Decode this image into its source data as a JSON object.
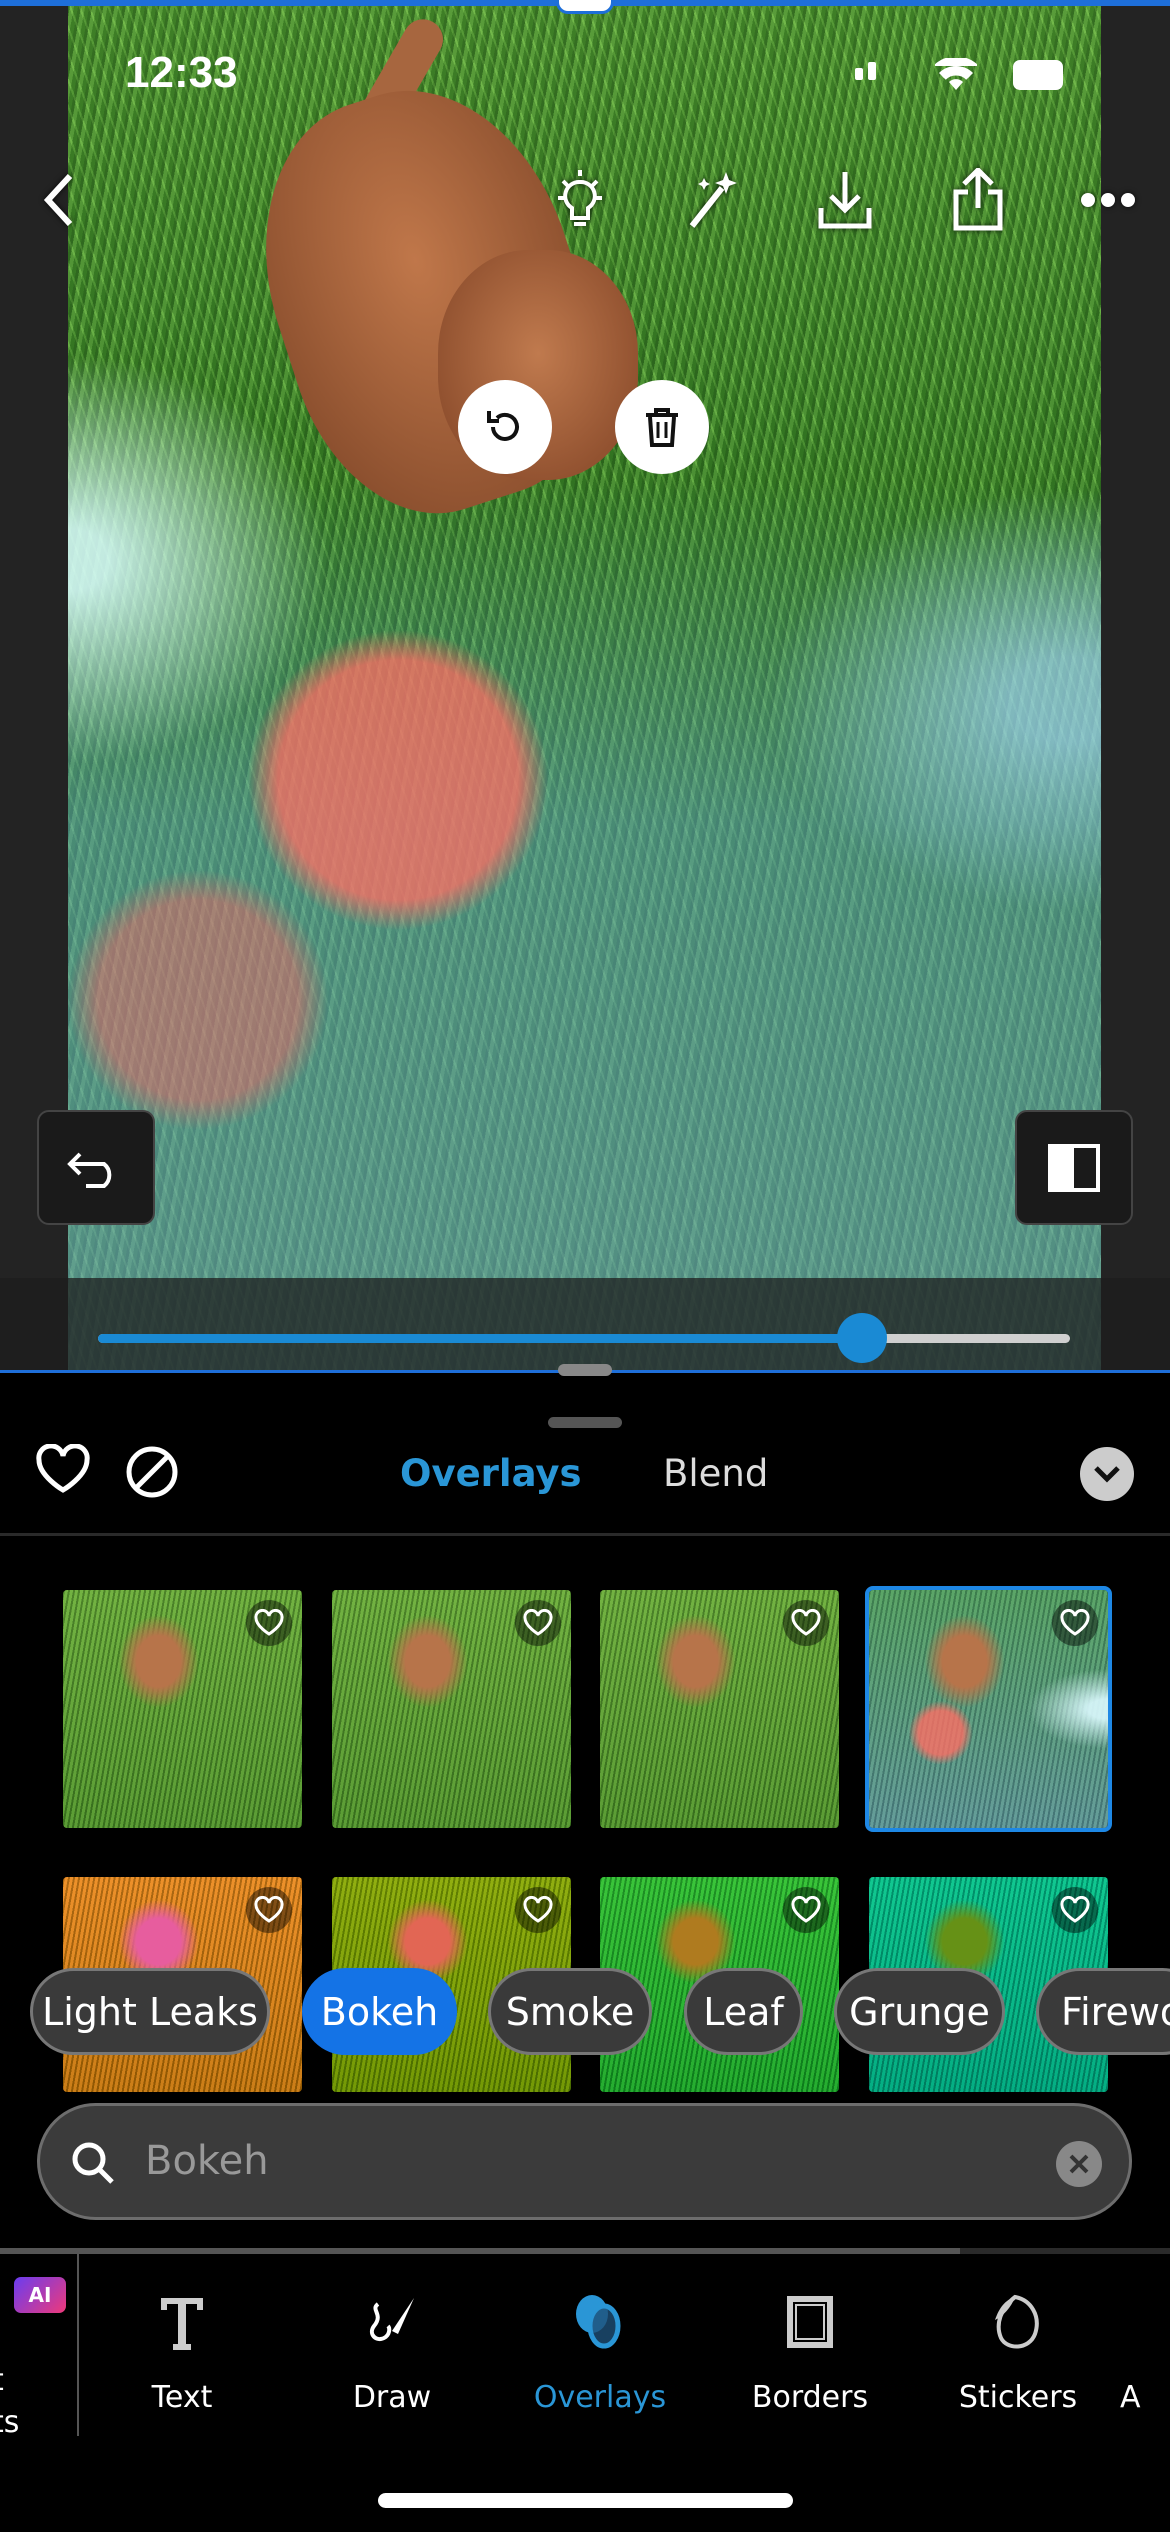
{
  "status_bar": {
    "time": "12:33"
  },
  "editor": {
    "slider_value": 0.786,
    "accent_color": "#1473e6"
  },
  "panel": {
    "tabs": [
      {
        "label": "Overlays",
        "active": true
      },
      {
        "label": "Blend",
        "active": false
      }
    ],
    "thumbnails_selected_index": 3,
    "categories": [
      {
        "label": "Light Leaks"
      },
      {
        "label": "Bokeh",
        "active": true
      },
      {
        "label": "Smoke"
      },
      {
        "label": "Leaf"
      },
      {
        "label": "Grunge"
      },
      {
        "label": "Firewo"
      }
    ],
    "search": {
      "value": "Bokeh"
    }
  },
  "bottom_tabs": [
    {
      "label": "t\nts",
      "partial": true,
      "badge": "AI"
    },
    {
      "label": "Text",
      "icon": "text-icon"
    },
    {
      "label": "Draw",
      "icon": "brush-icon"
    },
    {
      "label": "Overlays",
      "icon": "overlays-icon",
      "active": true
    },
    {
      "label": "Borders",
      "icon": "borders-icon"
    },
    {
      "label": "Stickers",
      "icon": "sticker-icon"
    },
    {
      "label": "A",
      "partial": true
    }
  ],
  "colors": {
    "active_tab": "#2a96d6",
    "chip_active": "#1473e6",
    "selection": "#1e6fd9"
  }
}
